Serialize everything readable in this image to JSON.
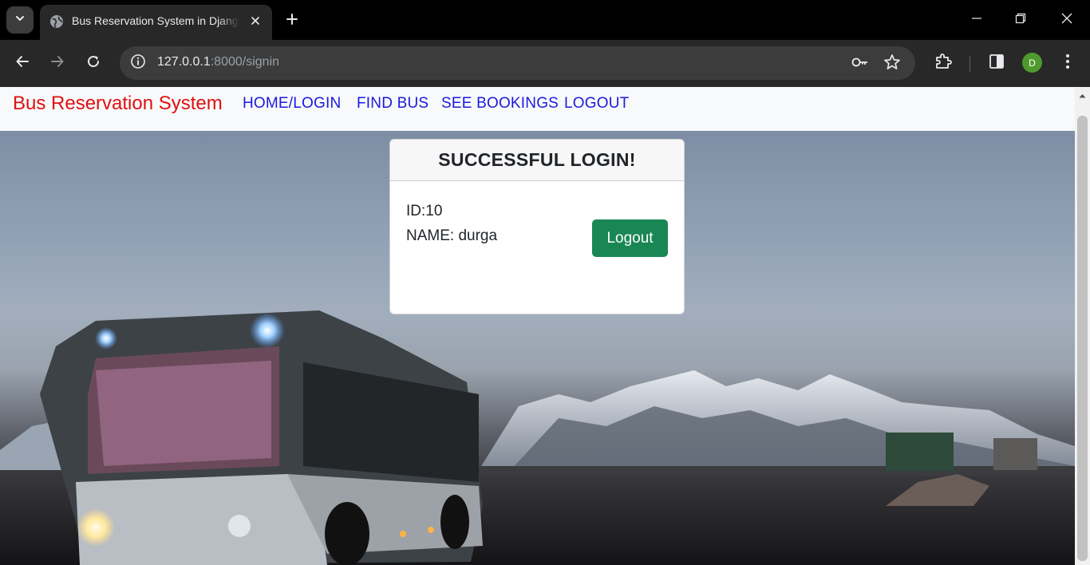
{
  "browser": {
    "tab_title": "Bus Reservation System in Django",
    "url_host": "127.0.0.1",
    "url_rest": ":8000/signin",
    "profile_initial": "D"
  },
  "navbar": {
    "brand": "Bus Reservation System",
    "links": [
      "HOME/LOGIN",
      "FIND BUS",
      "SEE BOOKINGS",
      "LOGOUT"
    ]
  },
  "card": {
    "title": "SUCCESSFUL LOGIN!",
    "id_line": "ID:10",
    "name_line": "NAME: durga",
    "button_label": "Logout"
  },
  "colors": {
    "brand": "#e01010",
    "nav_link": "#1a1adf",
    "button": "#198754",
    "profile": "#4e9a2e"
  }
}
